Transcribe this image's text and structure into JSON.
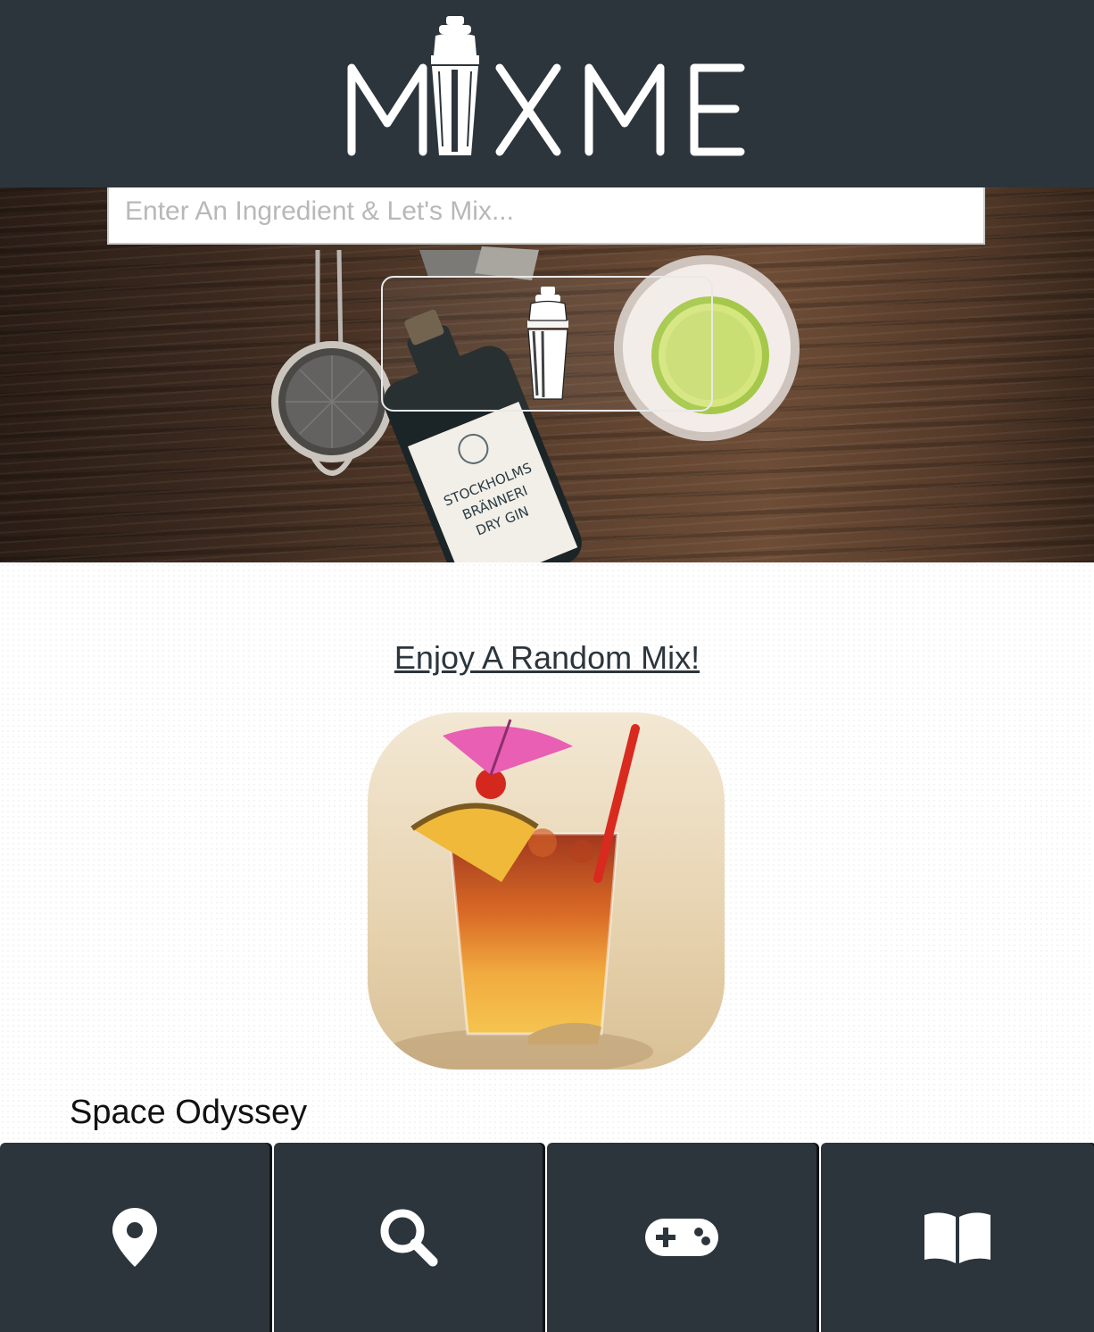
{
  "header": {
    "logo_text": "MIX ME",
    "accent_color": "#2c353c"
  },
  "search": {
    "placeholder": "Enter An Ingredient & Let's Mix...",
    "value": ""
  },
  "hero": {
    "bottle_label": [
      "STOCKHOLMS",
      "BRÄNNERI",
      "DRY GIN"
    ],
    "mix_button_icon": "cocktail-shaker-icon"
  },
  "random": {
    "link_label": "Enjoy A Random Mix!",
    "drink_name": "Space Odyssey"
  },
  "nav": {
    "items": [
      {
        "icon": "map-marker-icon"
      },
      {
        "icon": "search-icon"
      },
      {
        "icon": "gamepad-icon"
      },
      {
        "icon": "book-icon"
      }
    ]
  }
}
